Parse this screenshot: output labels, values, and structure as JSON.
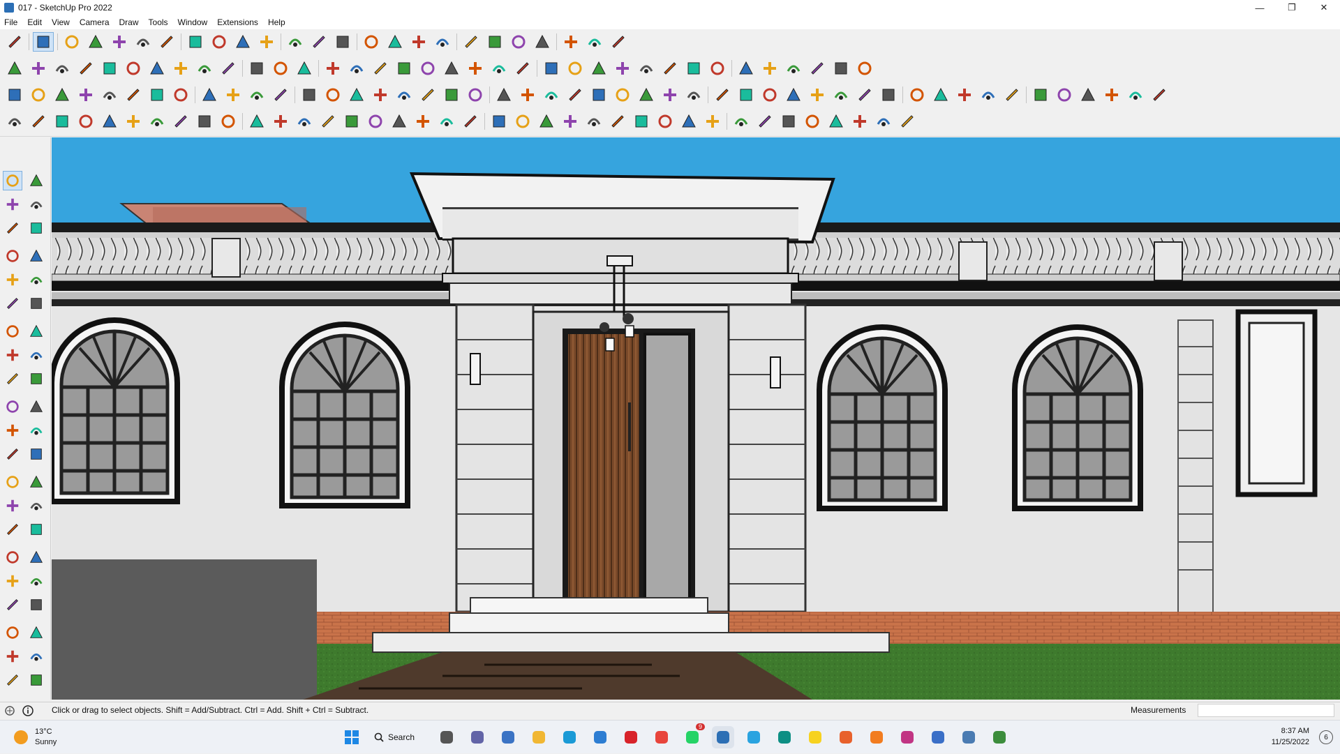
{
  "window": {
    "title": "017 - SketchUp Pro 2022",
    "minimize_glyph": "—",
    "maximize_glyph": "❐",
    "close_glyph": "✕"
  },
  "menu": [
    "File",
    "Edit",
    "View",
    "Camera",
    "Draw",
    "Tools",
    "Window",
    "Extensions",
    "Help"
  ],
  "statusbar": {
    "hint": "Click or drag to select objects. Shift = Add/Subtract. Ctrl = Add. Shift + Ctrl = Subtract.",
    "measurements_label": "Measurements",
    "measurements_value": ""
  },
  "taskbar": {
    "temperature": "13°C",
    "condition": "Sunny",
    "search_label": "Search",
    "time": "8:37 AM",
    "date": "11/25/2022",
    "notifications": "6",
    "whatsapp_badge": "9"
  },
  "colors": {
    "sky": "#36a4de",
    "grass": "#3e7a2d",
    "brick": "#c9734a",
    "facade": "#e6e6e6",
    "door_wood": "#7a4a2a"
  },
  "icons": {
    "toolbar_row1": [
      "zoom-icon",
      "select-icon",
      "eraser-icon",
      "pencil-icon",
      "lasso-icon",
      "paint-bucket-icon",
      "push-pull-icon",
      "follow-me-icon",
      "move-icon",
      "rotate-icon",
      "scale-icon",
      "tape-measure-icon",
      "text-icon",
      "paint-icon",
      "orbit-icon",
      "pan-icon",
      "zoom-window-icon",
      "zoom-extents-icon",
      "warehouse-icon",
      "extension-warehouse-icon",
      "layout-icon",
      "styles-icon",
      "account-icon",
      "sandbox-icon",
      "profile-icon"
    ],
    "left_tools": [
      "select-icon",
      "orbit-icon",
      "paint-bucket-icon",
      "eraser-icon",
      "component-icon",
      "tag-icon",
      "line-icon",
      "freehand-icon",
      "rectangle-icon",
      "rotated-rectangle-icon",
      "circle-icon",
      "polygon-icon",
      "arc-icon",
      "pie-icon",
      "arc-3pt-icon",
      "push-pull-icon",
      "move-icon",
      "follow-me-icon",
      "rotate-icon",
      "offset-icon",
      "scale-icon",
      "follow-me-2-icon",
      "tape-measure-icon",
      "dimension-icon",
      "protractor-icon",
      "text-icon",
      "axes-icon",
      "3d-text-icon",
      "orbit-2-icon",
      "pan-icon",
      "zoom-icon",
      "zoom-window-icon",
      "zoom-extents-icon",
      "previous-view-icon",
      "walk-icon",
      "look-around-icon",
      "position-camera-icon",
      "section-plane-icon",
      "warehouse-icon",
      "extension-icon",
      "layout-icon",
      "styles-icon"
    ]
  }
}
